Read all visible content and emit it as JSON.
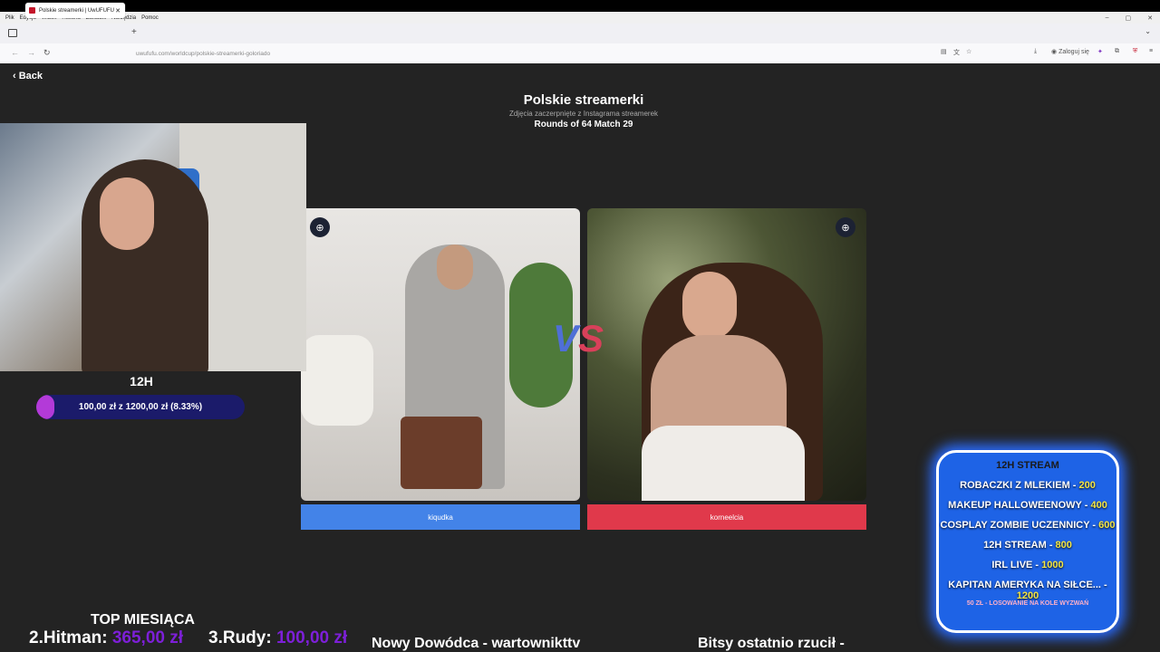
{
  "browser": {
    "menu": [
      "Plik",
      "Edycja",
      "Widok",
      "Historia",
      "Zakładki",
      "Narzędzia",
      "Pomoc"
    ],
    "tab_title": "Polskie streamerki | UwUFUFU",
    "url": "uwufufu.com/worldcup/polskie-streamerki-goloriado",
    "login": "Zaloguj się"
  },
  "page": {
    "back": "Back",
    "title": "Polskie streamerki",
    "subtitle": "Zdjęcia zaczerpnięte z Instagrama streamerek",
    "round": "Rounds of 64 Match 29",
    "vs_v": "V",
    "vs_s": "S",
    "choices": [
      "kiqudka",
      "korneelcia"
    ]
  },
  "overlay": {
    "timer": "12H",
    "progress_text": "100,00 zł z 1200,00 zł (8.33%)",
    "progress_fraction": 0.0833,
    "top_title": "TOP MIESIĄCA",
    "rank2_label": "2.Hitman:",
    "rank2_value": "365,00 zł",
    "rank3_label": "3.Rudy:",
    "rank3_value": "100,00 zł",
    "ticker1": "Nowy Dowódca - wartownikttv",
    "ticker2": "Bitsy ostatnio rzucił -",
    "panel": {
      "head": "12H STREAM",
      "items": [
        {
          "label": "ROBACZKI Z MLEKIEM -",
          "amount": "200"
        },
        {
          "label": "MAKEUP HALLOWEENOWY -",
          "amount": "400"
        },
        {
          "label": "COSPLAY ZOMBIE UCZENNICY -",
          "amount": "600"
        },
        {
          "label": "12H STREAM -",
          "amount": "800"
        },
        {
          "label": "IRL LIVE -",
          "amount": "1000"
        },
        {
          "label": "KAPITAN AMERYKA NA SIŁCE... -",
          "amount": "1200"
        }
      ],
      "foot": "50 ZŁ - LOSOWANIE NA KOLE WYZWAŃ"
    }
  }
}
